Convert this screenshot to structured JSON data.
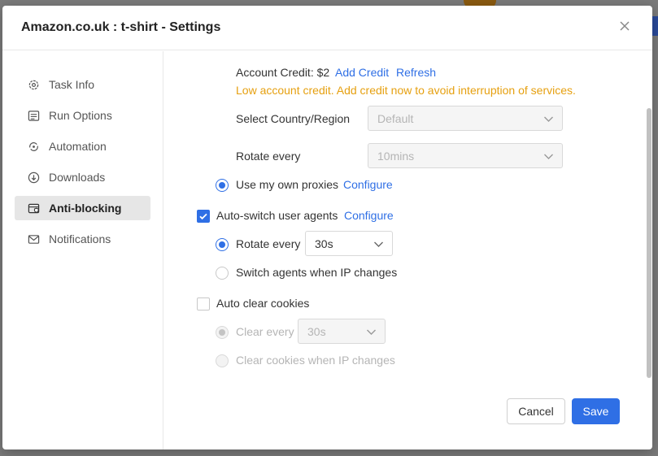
{
  "dialog": {
    "title": "Amazon.co.uk : t-shirt - Settings"
  },
  "sidebar": {
    "items": [
      {
        "label": "Task Info",
        "icon": "gear-icon"
      },
      {
        "label": "Run Options",
        "icon": "list-icon"
      },
      {
        "label": "Automation",
        "icon": "automation-icon"
      },
      {
        "label": "Downloads",
        "icon": "download-icon"
      },
      {
        "label": "Anti-blocking",
        "icon": "shield-browser-icon",
        "active": true
      },
      {
        "label": "Notifications",
        "icon": "mail-icon"
      }
    ]
  },
  "proxy": {
    "account_credit_label": "Account Credit: $2",
    "add_credit": "Add Credit",
    "refresh": "Refresh",
    "low_credit_warning": "Low account credit. Add credit now to avoid interruption of services.",
    "country_label": "Select Country/Region",
    "country_value": "Default",
    "rotate_label": "Rotate every",
    "rotate_value": "10mins",
    "own_proxies_label": "Use my own proxies",
    "own_proxies_configure": "Configure"
  },
  "user_agents": {
    "label": "Auto-switch user agents",
    "checked": true,
    "configure": "Configure",
    "rotate_label": "Rotate every",
    "rotate_value": "30s",
    "switch_ip_label": "Switch agents when IP changes"
  },
  "cookies": {
    "label": "Auto clear cookies",
    "checked": false,
    "clear_every_label": "Clear every",
    "clear_every_value": "30s",
    "clear_ip_label": "Clear cookies when IP changes"
  },
  "footer": {
    "cancel": "Cancel",
    "save": "Save"
  },
  "colors": {
    "accent": "#2f6fe5",
    "warning": "#e6a010"
  }
}
